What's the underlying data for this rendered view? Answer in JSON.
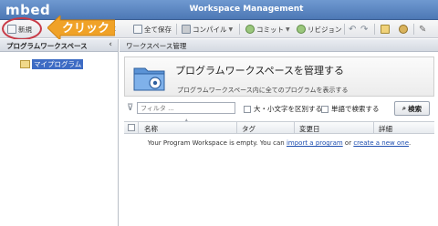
{
  "app": {
    "brand": "mbed",
    "window_title": "Workspace Management"
  },
  "toolbar": {
    "new_label": "新規",
    "save_label": "保存",
    "save_all_label": "全て保存",
    "compile_label": "コンパイル",
    "commit_label": "コミット",
    "revision_label": "リビジョン"
  },
  "annotation": {
    "callout_text": "クリック",
    "ellipse_color": "#c83a46",
    "arrow_color": "#f0a227"
  },
  "left_panel": {
    "title": "プログラムワークスペース",
    "tree_items": [
      {
        "label": "マイプログラム",
        "icon": "folder-icon"
      }
    ]
  },
  "right_panel": {
    "title": "ワークスペース管理",
    "banner_title": "プログラムワークスペースを管理する",
    "banner_subtitle": "プログラムワークスペース内に全てのプログラムを表示する",
    "filter_placeholder": "フィルタ ...",
    "case_sensitive_label": "大・小文字を区別する",
    "whole_word_label": "単語で検索する",
    "search_button": "検索",
    "columns": [
      "名称",
      "タグ",
      "変更日",
      "詳細"
    ],
    "empty_text_1": "Your Program Workspace is empty. You can ",
    "empty_link_1": "import a program",
    "empty_text_2": " or ",
    "empty_link_2": "create a new one",
    "empty_text_3": "."
  },
  "colors": {
    "titlebar": "#5a86c2",
    "selection": "#3d6bc4",
    "link": "#1f4fb0"
  }
}
